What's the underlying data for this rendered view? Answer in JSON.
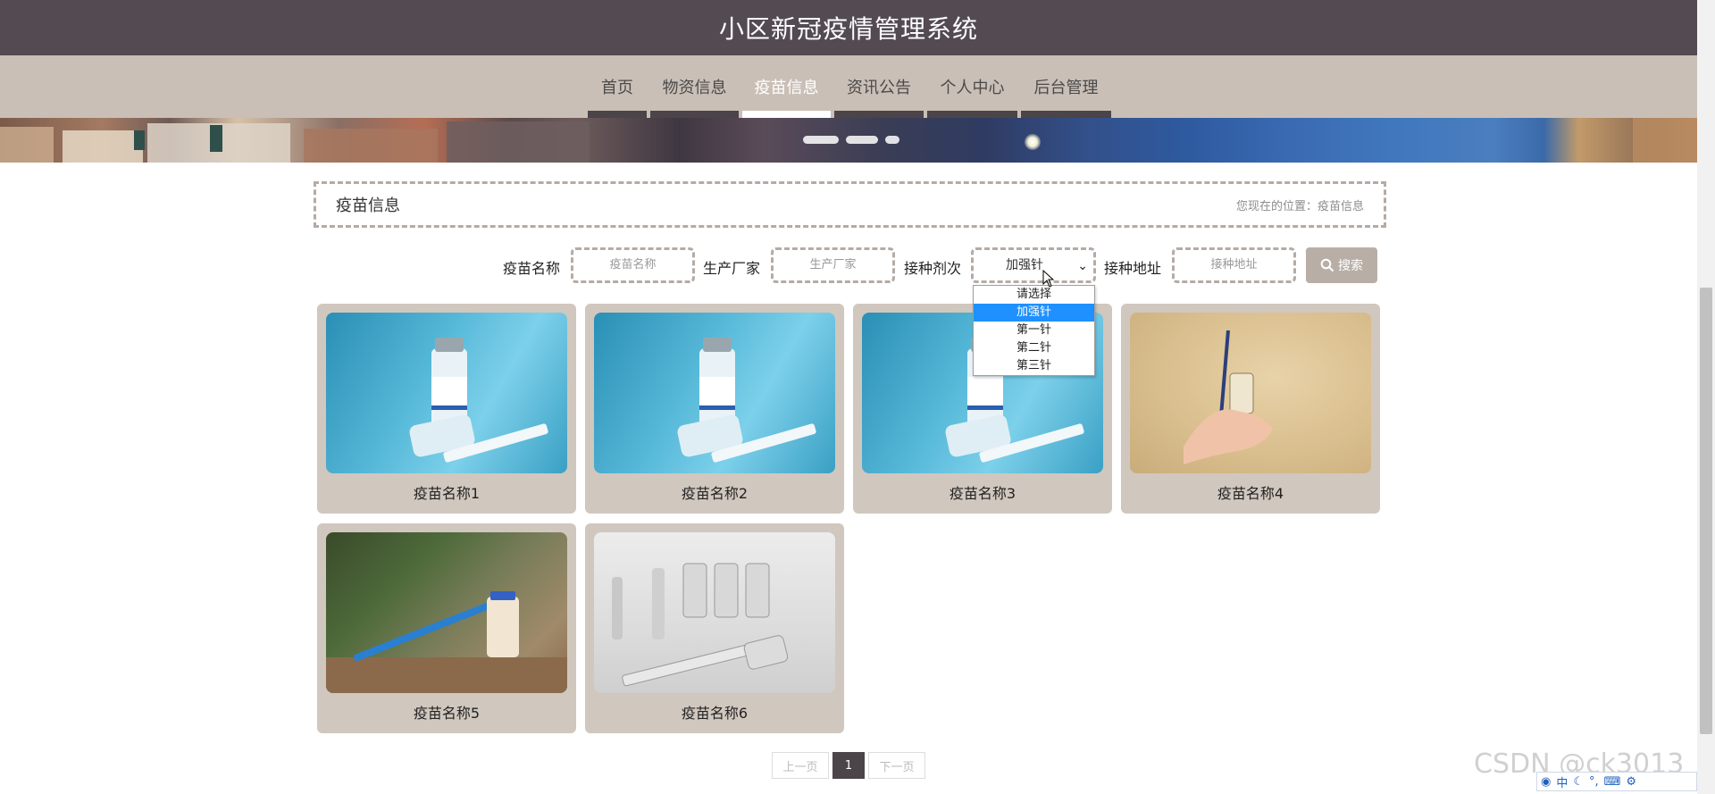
{
  "header": {
    "title": "小区新冠疫情管理系统"
  },
  "nav": {
    "items": [
      {
        "label": "首页"
      },
      {
        "label": "物资信息"
      },
      {
        "label": "疫苗信息"
      },
      {
        "label": "资讯公告"
      },
      {
        "label": "个人中心"
      },
      {
        "label": "后台管理"
      }
    ],
    "active": "疫苗信息"
  },
  "section": {
    "title": "疫苗信息",
    "location": "您现在的位置：疫苗信息"
  },
  "search": {
    "name_label": "疫苗名称",
    "name_placeholder": "疫苗名称",
    "maker_label": "生产厂家",
    "maker_placeholder": "生产厂家",
    "dose_label": "接种剂次",
    "dose_value": "加强针",
    "dose_options": [
      "请选择",
      "加强针",
      "第一针",
      "第二针",
      "第三针"
    ],
    "address_label": "接种地址",
    "address_placeholder": "接种地址",
    "button_label": "搜索"
  },
  "cards": [
    {
      "name": "疫苗名称1",
      "image": "influenza-vaccine-vial-syringe"
    },
    {
      "name": "疫苗名称2",
      "image": "influenza-vaccine-vial-syringe"
    },
    {
      "name": "疫苗名称3",
      "image": "influenza-vaccine-vial-syringe"
    },
    {
      "name": "疫苗名称4",
      "image": "hand-holding-syringe-vial"
    },
    {
      "name": "疫苗名称5",
      "image": "syringe-and-vial-on-table"
    },
    {
      "name": "疫苗名称6",
      "image": "glass-vials-and-syringe"
    }
  ],
  "pagination": {
    "prev": "上一页",
    "current": "1",
    "next": "下一页"
  },
  "watermark": "CSDN @ck3013",
  "ime": {
    "mode": "中"
  },
  "colors": {
    "header_bg": "#534a52",
    "nav_bg": "#c9bfb6",
    "card_bg": "#d0c7be",
    "select_highlight": "#1e90ff"
  }
}
